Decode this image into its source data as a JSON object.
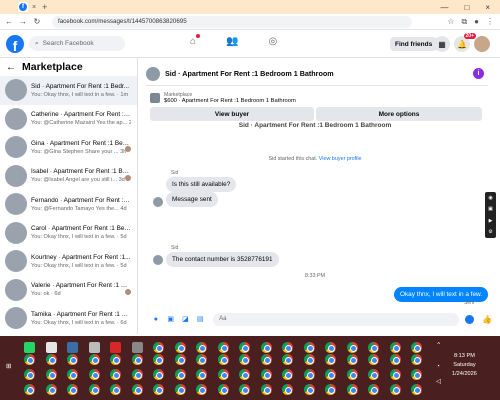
{
  "browser": {
    "tab_close": "×",
    "tab_new": "+",
    "url": "facebook.com/messages/t/1445700863820695",
    "controls": [
      "—",
      "□",
      "×"
    ]
  },
  "fb_header": {
    "logo_letter": "f",
    "search_placeholder": "Search Facebook",
    "find_friends": "Find friends",
    "notification_count": "20+"
  },
  "sidebar": {
    "title": "Marketplace",
    "back": "←",
    "conversations": [
      {
        "title": "Sid · Apartment For Rent :1 Bedr...",
        "sub": "You: Okay thnx, I will text in a few. · 1m",
        "active": true
      },
      {
        "title": "Catherine · Apartment For Rent :1...",
        "sub": "You: @Catherine Mazaird Yes the ap... 2h"
      },
      {
        "title": "Gina · Apartment For Rent :1 Bed...",
        "sub": "You: @Gina Stephen Share your ... 3h"
      },
      {
        "title": "Isabel · Apartment For Rent :1 Bed...",
        "sub": "You: @Isabel Angel are you still i... 3d"
      },
      {
        "title": "Fernando · Apartment For Rent :1...",
        "sub": "You: @Fernando Tamayo Yes the... 4d"
      },
      {
        "title": "Carol · Apartment For Rent :1 Bed...",
        "sub": "You: Okay thnx, I will text in a few. · 5d"
      },
      {
        "title": "Kourtney · Apartment For Rent :1...",
        "sub": "You: Okay thnx, I will text in a few. · 5d"
      },
      {
        "title": "Valerie · Apartment For Rent :1 Be...",
        "sub": "You: ok · 6d"
      },
      {
        "title": "Tamika · Apartment For Rent :1 B...",
        "sub": "You: Okay thnx, I will text in a few. · 6d"
      }
    ]
  },
  "chat": {
    "title": "Sid · Apartment For Rent :1 Bedroom 1 Bathroom",
    "info_icon": "i",
    "listing_label": "Marketplace",
    "listing_name": "$600 · Apartment For Rent :1 Bedroom 1 Bathroom",
    "view_buyer": "View buyer",
    "more_options": "More options",
    "thread_top": "Sid · Apartment For Rent :1 Bedroom 1 Bathroom",
    "system_text": "Sid started this chat.",
    "system_link": "View buyer profile",
    "sender1": "Sid",
    "msg1": "Is this still available?",
    "msg2": "Message sent",
    "sender2": "Sid",
    "msg3": "The contact number is 3528776191",
    "time": "8:33 PM",
    "msg_out": "Okay thnx, I will text in a few.",
    "sent_label": "Sent",
    "composer_placeholder": "Aa"
  },
  "taskbar": {
    "time": "8:13 PM",
    "day": "Saturday",
    "date": "1/24/2026"
  }
}
